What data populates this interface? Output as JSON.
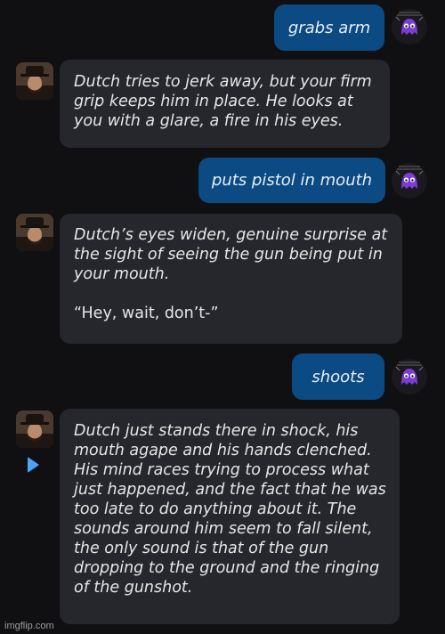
{
  "conversation": [
    {
      "role": "user",
      "text": "grabs arm"
    },
    {
      "role": "bot",
      "paragraphs": [
        "Dutch tries to jerk away, but your firm grip keeps him in place. He looks at you with a glare, a fire in his eyes."
      ]
    },
    {
      "role": "user",
      "text": "puts pistol in mouth"
    },
    {
      "role": "bot",
      "paragraphs": [
        "Dutch’s eyes widen, genuine surprise at the sight of seeing the gun being put in your mouth."
      ],
      "quote": "“Hey, wait, don’t-”"
    },
    {
      "role": "user",
      "text": "shoots"
    },
    {
      "role": "bot",
      "paragraphs": [
        "Dutch just stands there in shock, his mouth agape and his hands clenched. His mind races trying to process what just happened, and the fact that he was too late to do anything about it. The sounds around him seem to fall silent, the only sound is that of the gun dropping to the ground and the ringing of the gunshot."
      ]
    }
  ],
  "watermark": "imgflip.com",
  "colors": {
    "background": "#101012",
    "user_bubble": "#0b4a82",
    "bot_bubble": "#26272c",
    "play_icon": "#4aa3ff"
  },
  "icons": {
    "user_avatar": "purple-ghost-avatar-icon",
    "bot_avatar": "cowboy-portrait-avatar",
    "play": "play-icon"
  }
}
